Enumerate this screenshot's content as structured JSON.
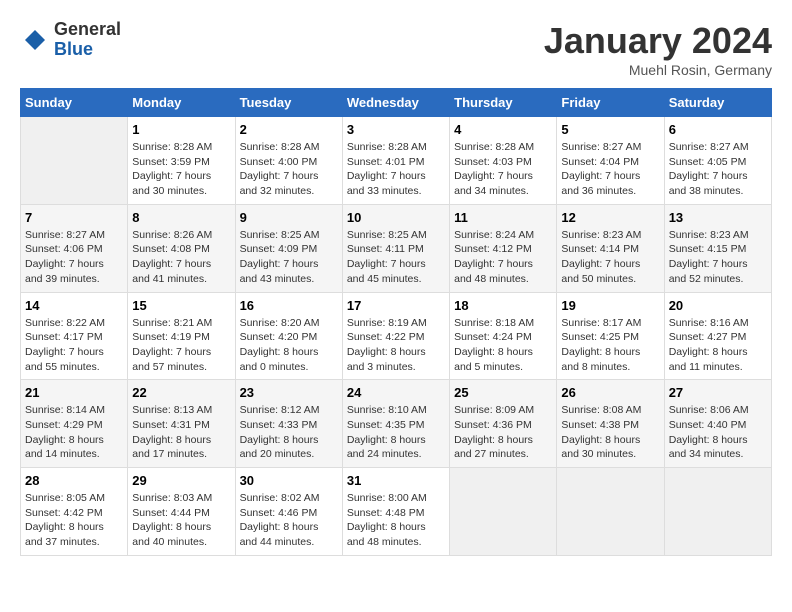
{
  "header": {
    "logo": {
      "general": "General",
      "blue": "Blue"
    },
    "title": "January 2024",
    "location": "Muehl Rosin, Germany"
  },
  "weekdays": [
    "Sunday",
    "Monday",
    "Tuesday",
    "Wednesday",
    "Thursday",
    "Friday",
    "Saturday"
  ],
  "weeks": [
    [
      {
        "day": "",
        "info": ""
      },
      {
        "day": "1",
        "info": "Sunrise: 8:28 AM\nSunset: 3:59 PM\nDaylight: 7 hours\nand 30 minutes."
      },
      {
        "day": "2",
        "info": "Sunrise: 8:28 AM\nSunset: 4:00 PM\nDaylight: 7 hours\nand 32 minutes."
      },
      {
        "day": "3",
        "info": "Sunrise: 8:28 AM\nSunset: 4:01 PM\nDaylight: 7 hours\nand 33 minutes."
      },
      {
        "day": "4",
        "info": "Sunrise: 8:28 AM\nSunset: 4:03 PM\nDaylight: 7 hours\nand 34 minutes."
      },
      {
        "day": "5",
        "info": "Sunrise: 8:27 AM\nSunset: 4:04 PM\nDaylight: 7 hours\nand 36 minutes."
      },
      {
        "day": "6",
        "info": "Sunrise: 8:27 AM\nSunset: 4:05 PM\nDaylight: 7 hours\nand 38 minutes."
      }
    ],
    [
      {
        "day": "7",
        "info": "Sunrise: 8:27 AM\nSunset: 4:06 PM\nDaylight: 7 hours\nand 39 minutes."
      },
      {
        "day": "8",
        "info": "Sunrise: 8:26 AM\nSunset: 4:08 PM\nDaylight: 7 hours\nand 41 minutes."
      },
      {
        "day": "9",
        "info": "Sunrise: 8:25 AM\nSunset: 4:09 PM\nDaylight: 7 hours\nand 43 minutes."
      },
      {
        "day": "10",
        "info": "Sunrise: 8:25 AM\nSunset: 4:11 PM\nDaylight: 7 hours\nand 45 minutes."
      },
      {
        "day": "11",
        "info": "Sunrise: 8:24 AM\nSunset: 4:12 PM\nDaylight: 7 hours\nand 48 minutes."
      },
      {
        "day": "12",
        "info": "Sunrise: 8:23 AM\nSunset: 4:14 PM\nDaylight: 7 hours\nand 50 minutes."
      },
      {
        "day": "13",
        "info": "Sunrise: 8:23 AM\nSunset: 4:15 PM\nDaylight: 7 hours\nand 52 minutes."
      }
    ],
    [
      {
        "day": "14",
        "info": "Sunrise: 8:22 AM\nSunset: 4:17 PM\nDaylight: 7 hours\nand 55 minutes."
      },
      {
        "day": "15",
        "info": "Sunrise: 8:21 AM\nSunset: 4:19 PM\nDaylight: 7 hours\nand 57 minutes."
      },
      {
        "day": "16",
        "info": "Sunrise: 8:20 AM\nSunset: 4:20 PM\nDaylight: 8 hours\nand 0 minutes."
      },
      {
        "day": "17",
        "info": "Sunrise: 8:19 AM\nSunset: 4:22 PM\nDaylight: 8 hours\nand 3 minutes."
      },
      {
        "day": "18",
        "info": "Sunrise: 8:18 AM\nSunset: 4:24 PM\nDaylight: 8 hours\nand 5 minutes."
      },
      {
        "day": "19",
        "info": "Sunrise: 8:17 AM\nSunset: 4:25 PM\nDaylight: 8 hours\nand 8 minutes."
      },
      {
        "day": "20",
        "info": "Sunrise: 8:16 AM\nSunset: 4:27 PM\nDaylight: 8 hours\nand 11 minutes."
      }
    ],
    [
      {
        "day": "21",
        "info": "Sunrise: 8:14 AM\nSunset: 4:29 PM\nDaylight: 8 hours\nand 14 minutes."
      },
      {
        "day": "22",
        "info": "Sunrise: 8:13 AM\nSunset: 4:31 PM\nDaylight: 8 hours\nand 17 minutes."
      },
      {
        "day": "23",
        "info": "Sunrise: 8:12 AM\nSunset: 4:33 PM\nDaylight: 8 hours\nand 20 minutes."
      },
      {
        "day": "24",
        "info": "Sunrise: 8:10 AM\nSunset: 4:35 PM\nDaylight: 8 hours\nand 24 minutes."
      },
      {
        "day": "25",
        "info": "Sunrise: 8:09 AM\nSunset: 4:36 PM\nDaylight: 8 hours\nand 27 minutes."
      },
      {
        "day": "26",
        "info": "Sunrise: 8:08 AM\nSunset: 4:38 PM\nDaylight: 8 hours\nand 30 minutes."
      },
      {
        "day": "27",
        "info": "Sunrise: 8:06 AM\nSunset: 4:40 PM\nDaylight: 8 hours\nand 34 minutes."
      }
    ],
    [
      {
        "day": "28",
        "info": "Sunrise: 8:05 AM\nSunset: 4:42 PM\nDaylight: 8 hours\nand 37 minutes."
      },
      {
        "day": "29",
        "info": "Sunrise: 8:03 AM\nSunset: 4:44 PM\nDaylight: 8 hours\nand 40 minutes."
      },
      {
        "day": "30",
        "info": "Sunrise: 8:02 AM\nSunset: 4:46 PM\nDaylight: 8 hours\nand 44 minutes."
      },
      {
        "day": "31",
        "info": "Sunrise: 8:00 AM\nSunset: 4:48 PM\nDaylight: 8 hours\nand 48 minutes."
      },
      {
        "day": "",
        "info": ""
      },
      {
        "day": "",
        "info": ""
      },
      {
        "day": "",
        "info": ""
      }
    ]
  ]
}
